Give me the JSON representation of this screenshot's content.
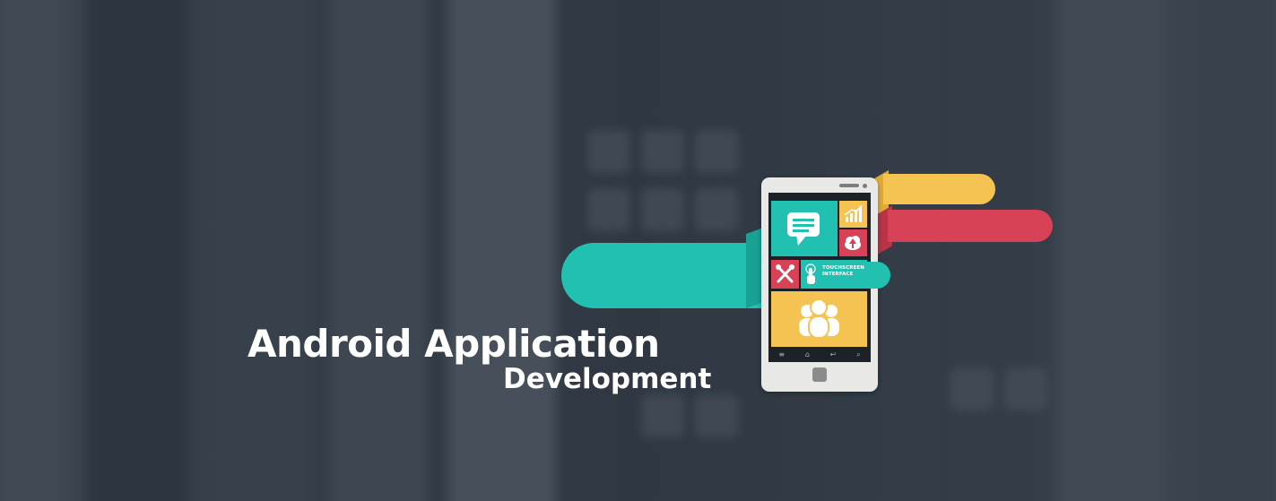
{
  "headline": {
    "title": "Android Application",
    "subtitle": "Development"
  },
  "phone": {
    "tiles": [
      {
        "name": "message",
        "icon": "chat-bubble-icon",
        "color": "#22c0b1"
      },
      {
        "name": "analytics",
        "icon": "bar-chart-icon",
        "color": "#f5c352"
      },
      {
        "name": "cloud-upload",
        "icon": "cloud-upload-icon",
        "color": "#d74257"
      },
      {
        "name": "tools",
        "icon": "tools-icon",
        "color": "#d74257"
      },
      {
        "name": "touchscreen",
        "icon": "touch-hand-icon",
        "color": "#22c0b1",
        "label": "TOUCHSCREEN INTERFACE"
      },
      {
        "name": "users",
        "icon": "people-icon",
        "color": "#f5c352"
      }
    ],
    "navbar": [
      "≡",
      "⌂",
      "↩",
      "⌕"
    ]
  },
  "colors": {
    "teal": "#22c0b1",
    "yellow": "#f5c352",
    "red": "#d74257",
    "background": "#3b4550"
  }
}
